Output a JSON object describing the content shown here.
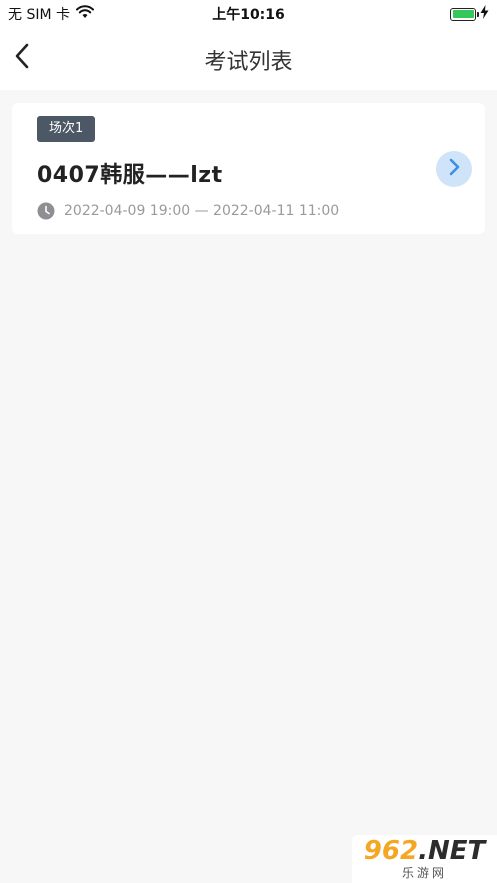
{
  "status_bar": {
    "carrier": "无 SIM 卡",
    "time": "上午10:16",
    "battery_level": 1.0
  },
  "nav": {
    "title": "考试列表",
    "back_icon": "chevron-left-icon"
  },
  "exams": [
    {
      "session": "场次1",
      "title": "0407韩服——lzt",
      "time_range": "2022-04-09 19:00 — 2022-04-11 11:00",
      "action_icon": "chevron-right-icon"
    }
  ],
  "watermark": {
    "number": "962",
    "suffix": ".NET",
    "subtitle": "乐游网"
  },
  "colors": {
    "badge_bg": "#4d5866",
    "action_bg": "#cfe4f9",
    "action_icon": "#3d8fe0",
    "battery": "#34c759",
    "page_bg": "#f7f7f7"
  }
}
